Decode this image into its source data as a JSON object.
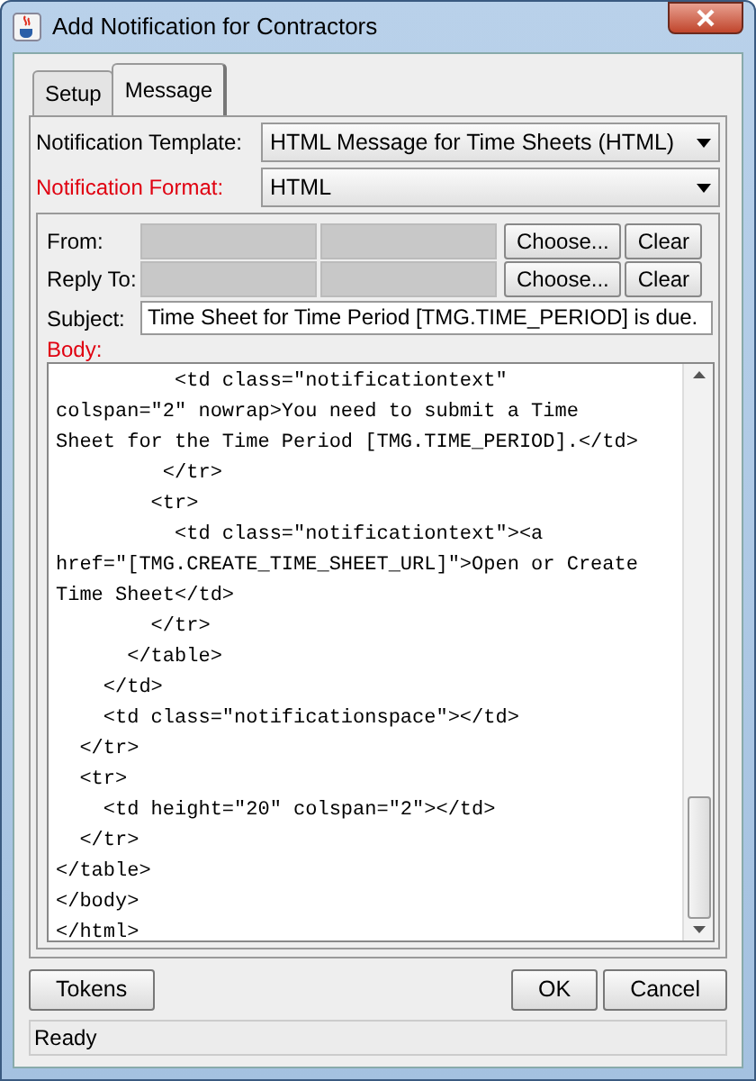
{
  "window": {
    "title": "Add Notification for Contractors"
  },
  "tabs": [
    {
      "label": "Setup",
      "selected": false
    },
    {
      "label": "Message",
      "selected": true
    }
  ],
  "fields": [
    {
      "label": "Notification Template:",
      "value": "HTML Message for Time Sheets (HTML)",
      "required": false
    },
    {
      "label": "Notification Format:",
      "value": "HTML",
      "required": true
    }
  ],
  "recipients": [
    {
      "label": "From:",
      "buttons": [
        "Choose...",
        "Clear"
      ]
    },
    {
      "label": "Reply To:",
      "buttons": [
        "Choose...",
        "Clear"
      ]
    }
  ],
  "subject": {
    "label": "Subject:",
    "value": "Time Sheet for Time Period [TMG.TIME_PERIOD] is due."
  },
  "body": {
    "label": "Body:",
    "required": true,
    "lines": [
      "          <td class=\"notificationtext\"",
      "colspan=\"2\" nowrap>You need to submit a Time",
      "Sheet for the Time Period [TMG.TIME_PERIOD].</td>",
      "         </tr>",
      "        <tr>",
      "          <td class=\"notificationtext\"><a",
      "href=\"[TMG.CREATE_TIME_SHEET_URL]\">Open or Create",
      "Time Sheet</td>",
      "        </tr>",
      "      </table>",
      "    </td>",
      "    <td class=\"notificationspace\"></td>",
      "  </tr>",
      "  <tr>",
      "    <td height=\"20\" colspan=\"2\"></td>",
      "  </tr>",
      "</table>",
      "</body>",
      "</html>"
    ]
  },
  "buttons_left": [
    "Tokens"
  ],
  "buttons_right": [
    "OK",
    "Cancel"
  ],
  "status_bar": "Ready"
}
